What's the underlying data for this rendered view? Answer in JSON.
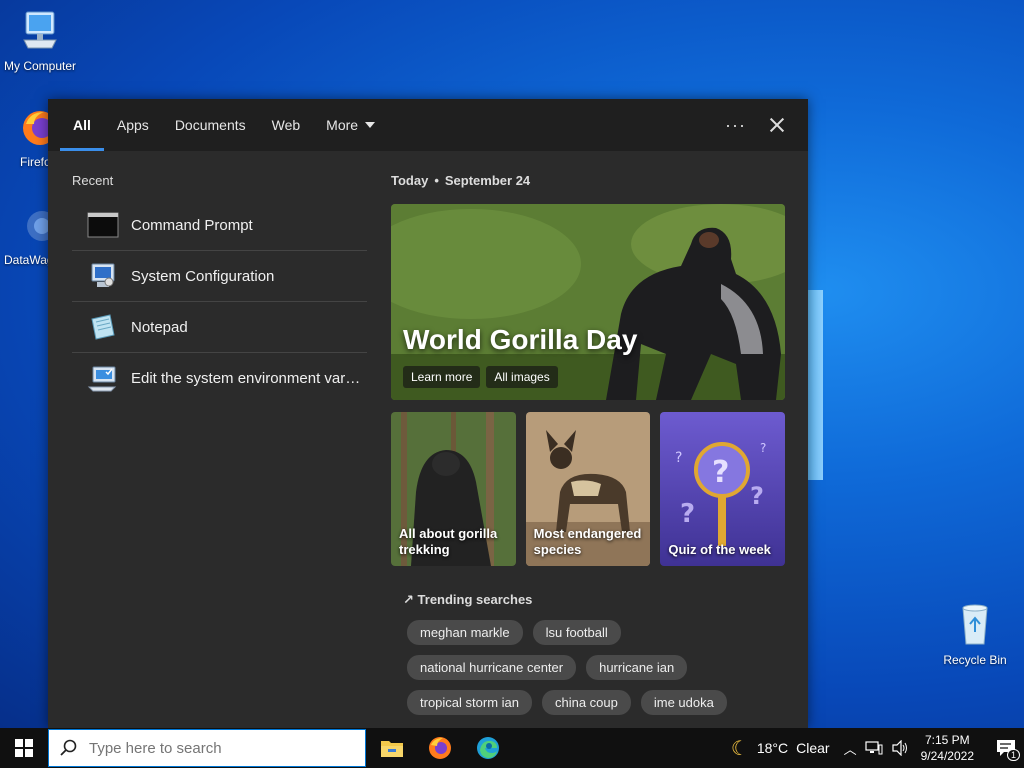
{
  "desktop": {
    "icons": [
      {
        "label": "My Computer"
      },
      {
        "label": "Firefox"
      },
      {
        "label": "DataWag"
      },
      {
        "label": "Recycle Bin"
      }
    ]
  },
  "search_panel": {
    "tabs": [
      {
        "label": "All",
        "active": true
      },
      {
        "label": "Apps"
      },
      {
        "label": "Documents"
      },
      {
        "label": "Web"
      },
      {
        "label": "More"
      }
    ],
    "options_label": "···",
    "recent": {
      "title": "Recent",
      "items": [
        {
          "label": "Command Prompt",
          "icon": "command-prompt-icon"
        },
        {
          "label": "System Configuration",
          "icon": "system-configuration-icon"
        },
        {
          "label": "Notepad",
          "icon": "notepad-icon"
        },
        {
          "label": "Edit the system environment variables",
          "icon": "system-environment-icon"
        }
      ]
    },
    "today": {
      "label": "Today",
      "date": "September 24",
      "hero": {
        "title": "World Gorilla Day",
        "buttons": [
          "Learn more",
          "All images"
        ]
      },
      "cards": [
        {
          "label": "All about gorilla trekking"
        },
        {
          "label": "Most endangered species"
        },
        {
          "label": "Quiz of the week"
        }
      ]
    },
    "trending": {
      "title": "Trending searches",
      "items": [
        "meghan markle",
        "lsu football",
        "national hurricane center",
        "hurricane ian",
        "tropical storm ian",
        "china coup",
        "ime udoka"
      ]
    }
  },
  "taskbar": {
    "search_placeholder": "Type here to search",
    "weather": {
      "temp": "18°C",
      "condition": "Clear"
    },
    "clock": {
      "time": "7:15 PM",
      "date": "9/24/2022"
    },
    "notification_count": "1"
  },
  "colors": {
    "accent": "#3a8eea",
    "panel_bg": "#2b2b2b",
    "taskbar_bg": "#101010"
  }
}
